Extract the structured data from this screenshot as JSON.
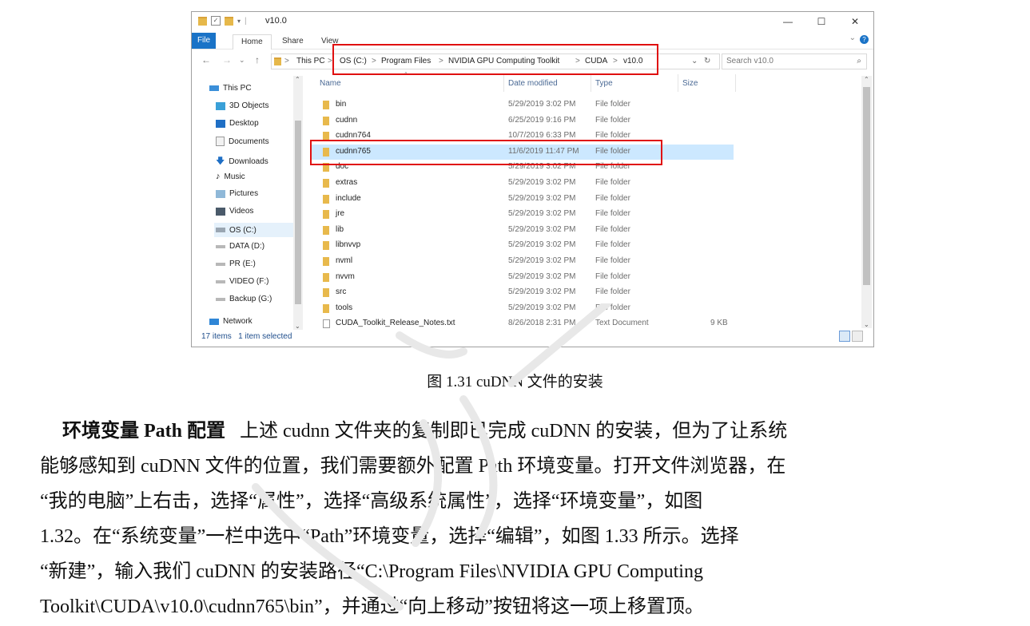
{
  "window": {
    "title": "v10.0",
    "controls": {
      "minimize": "—",
      "maximize": "☐",
      "close": "✕"
    },
    "ribbon_tabs": [
      "File",
      "Home",
      "Share",
      "View"
    ],
    "address": {
      "segments": [
        "This PC",
        "OS (C:)",
        "Program Files",
        "NVIDIA GPU Computing Toolkit",
        "CUDA",
        "v10.0"
      ],
      "separator": ">"
    },
    "search_placeholder": "Search v10.0",
    "sidebar": [
      {
        "label": "This PC",
        "icon": "computer-icon"
      },
      {
        "label": "3D Objects",
        "icon": "cube-icon"
      },
      {
        "label": "Desktop",
        "icon": "desktop-icon"
      },
      {
        "label": "Documents",
        "icon": "document-icon"
      },
      {
        "label": "Downloads",
        "icon": "download-icon"
      },
      {
        "label": "Music",
        "icon": "music-icon"
      },
      {
        "label": "Pictures",
        "icon": "picture-icon"
      },
      {
        "label": "Videos",
        "icon": "video-icon"
      },
      {
        "label": "OS (C:)",
        "icon": "drive-icon"
      },
      {
        "label": "DATA (D:)",
        "icon": "drive-icon"
      },
      {
        "label": "PR (E:)",
        "icon": "drive-icon"
      },
      {
        "label": "VIDEO (F:)",
        "icon": "drive-icon"
      },
      {
        "label": "Backup (G:)",
        "icon": "drive-icon"
      },
      {
        "label": "Network",
        "icon": "network-icon"
      }
    ],
    "columns": [
      "Name",
      "Date modified",
      "Type",
      "Size"
    ],
    "files": [
      {
        "name": "bin",
        "date": "5/29/2019 3:02 PM",
        "type": "File folder",
        "size": ""
      },
      {
        "name": "cudnn",
        "date": "6/25/2019 9:16 PM",
        "type": "File folder",
        "size": ""
      },
      {
        "name": "cudnn764",
        "date": "10/7/2019 6:33 PM",
        "type": "File folder",
        "size": ""
      },
      {
        "name": "cudnn765",
        "date": "11/6/2019 11:47 PM",
        "type": "File folder",
        "size": ""
      },
      {
        "name": "doc",
        "date": "5/29/2019 3:02 PM",
        "type": "File folder",
        "size": ""
      },
      {
        "name": "extras",
        "date": "5/29/2019 3:02 PM",
        "type": "File folder",
        "size": ""
      },
      {
        "name": "include",
        "date": "5/29/2019 3:02 PM",
        "type": "File folder",
        "size": ""
      },
      {
        "name": "jre",
        "date": "5/29/2019 3:02 PM",
        "type": "File folder",
        "size": ""
      },
      {
        "name": "lib",
        "date": "5/29/2019 3:02 PM",
        "type": "File folder",
        "size": ""
      },
      {
        "name": "libnvvp",
        "date": "5/29/2019 3:02 PM",
        "type": "File folder",
        "size": ""
      },
      {
        "name": "nvml",
        "date": "5/29/2019 3:02 PM",
        "type": "File folder",
        "size": ""
      },
      {
        "name": "nvvm",
        "date": "5/29/2019 3:02 PM",
        "type": "File folder",
        "size": ""
      },
      {
        "name": "src",
        "date": "5/29/2019 3:02 PM",
        "type": "File folder",
        "size": ""
      },
      {
        "name": "tools",
        "date": "5/29/2019 3:02 PM",
        "type": "File folder",
        "size": ""
      },
      {
        "name": "CUDA_Toolkit_Release_Notes.txt",
        "date": "8/26/2018 2:31 PM",
        "type": "Text Document",
        "size": "9 KB"
      }
    ],
    "status": {
      "items": "17 items",
      "selected": "1 item selected"
    }
  },
  "caption": "图  1.31 cuDNN 文件的安装",
  "paragraph": {
    "heading": "环境变量 Path 配置",
    "lines": [
      "上述 cudnn 文件夹的复制即已完成 cuDNN 的安装，但为了让系统",
      "能够感知到 cuDNN 文件的位置，我们需要额外配置 Path 环境变量。打开文件浏览器，在",
      "“我的电脑”上右击，选择“属性”，选择“高级系统属性”，选择“环境变量”，如图",
      "1.32。在“系统变量”一栏中选中“Path”环境变量，选择“编辑”，如图  1.33 所示。选择",
      "“新建”，输入我们 cuDNN 的安装路径“C:\\Program Files\\NVIDIA GPU Computing",
      "Toolkit\\CUDA\\v10.0\\cudnn765\\bin”，并通过“向上移动”按钮将这一项上移置顶。"
    ]
  },
  "colors": {
    "selection": "#cce8ff",
    "highlight_box": "#e01010",
    "accent": "#1a73c7"
  }
}
